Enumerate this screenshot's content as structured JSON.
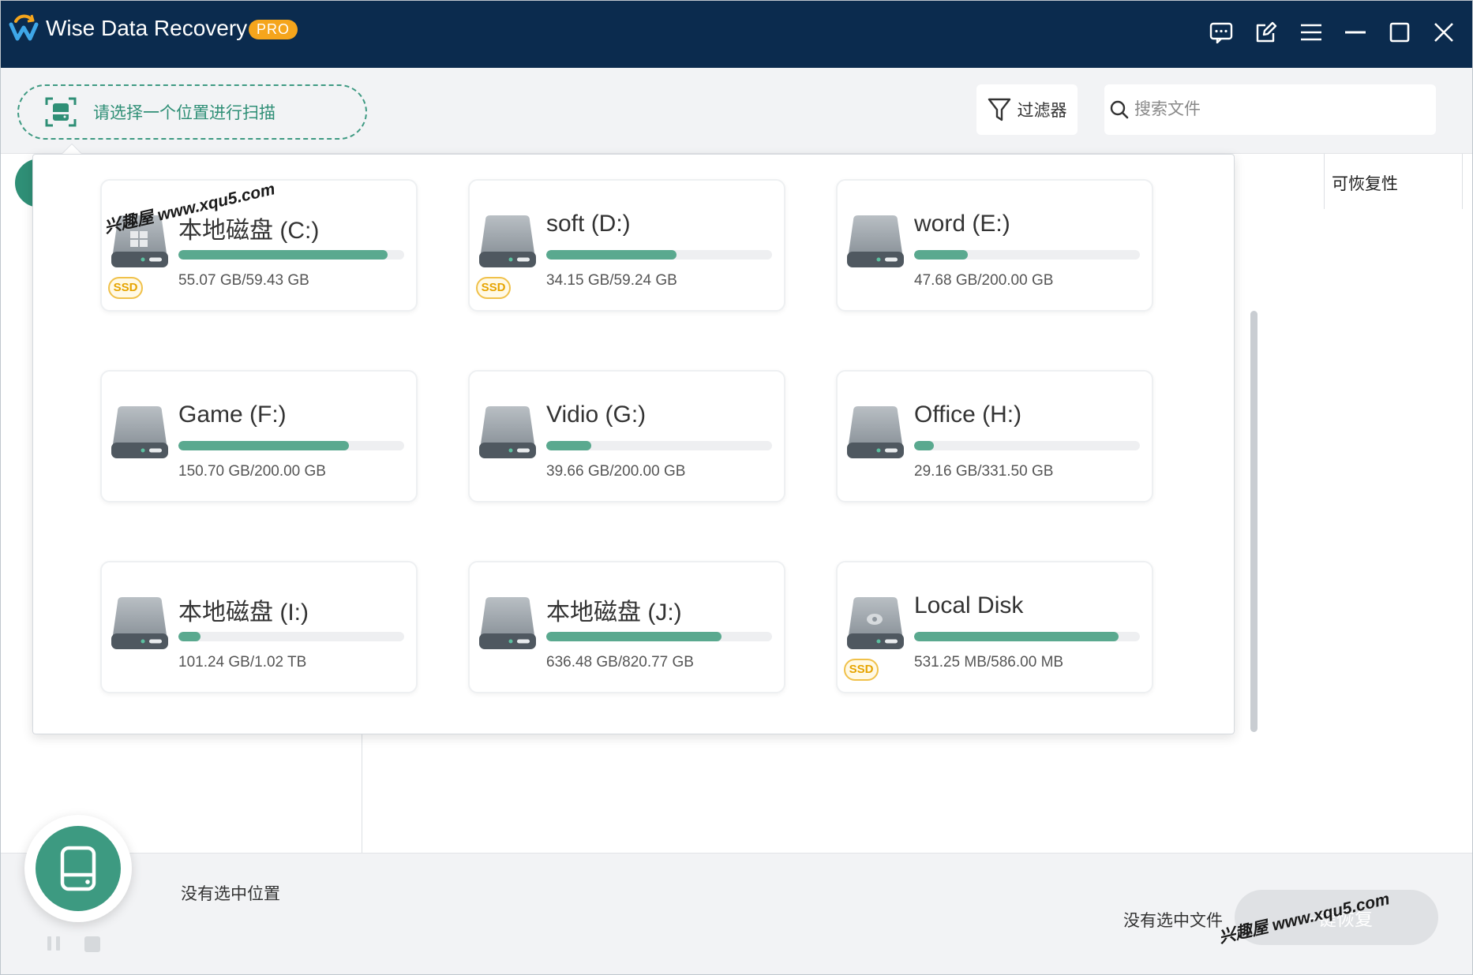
{
  "app": {
    "title": "Wise Data Recovery",
    "badge": "PRO"
  },
  "titlebar_buttons": [
    "feedback-icon",
    "edit-icon",
    "menu-icon",
    "minimize-icon",
    "maximize-icon",
    "close-icon"
  ],
  "toolbar": {
    "location_prompt": "请选择一个位置进行扫描",
    "filter_label": "过滤器",
    "search_placeholder": "搜索文件"
  },
  "column_header": "可恢复性",
  "drives": [
    {
      "name": "本地磁盘 (C:)",
      "usage": "55.07 GB/59.43 GB",
      "used_fraction": 0.927,
      "ssd": true,
      "icon": "windows-drive-icon"
    },
    {
      "name": "soft (D:)",
      "usage": "34.15 GB/59.24 GB",
      "used_fraction": 0.576,
      "ssd": true,
      "icon": "hard-drive-icon"
    },
    {
      "name": "word (E:)",
      "usage": "47.68 GB/200.00 GB",
      "used_fraction": 0.238,
      "ssd": false,
      "icon": "hard-drive-icon"
    },
    {
      "name": "Game (F:)",
      "usage": "150.70 GB/200.00 GB",
      "used_fraction": 0.754,
      "ssd": false,
      "icon": "hard-drive-icon"
    },
    {
      "name": "Vidio (G:)",
      "usage": "39.66 GB/200.00 GB",
      "used_fraction": 0.198,
      "ssd": false,
      "icon": "hard-drive-icon"
    },
    {
      "name": "Office (H:)",
      "usage": "29.16 GB/331.50 GB",
      "used_fraction": 0.088,
      "ssd": false,
      "icon": "hard-drive-icon"
    },
    {
      "name": "本地磁盘 (I:)",
      "usage": "101.24 GB/1.02 TB",
      "used_fraction": 0.097,
      "ssd": false,
      "icon": "hard-drive-icon"
    },
    {
      "name": "本地磁盘 (J:)",
      "usage": "636.48 GB/820.77 GB",
      "used_fraction": 0.775,
      "ssd": false,
      "icon": "hard-drive-icon"
    },
    {
      "name": "Local Disk",
      "usage": "531.25 MB/586.00 MB",
      "used_fraction": 0.907,
      "ssd": true,
      "icon": "system-drive-icon"
    }
  ],
  "ssd_label": "SSD",
  "bottom": {
    "no_location": "没有选中位置",
    "no_file": "没有选中文件",
    "recover_label": "一键恢复"
  },
  "watermark": "兴趣屋 www.xqu5.com",
  "colors": {
    "titlebar": "#0b2b4e",
    "accent": "#3d9a81",
    "pro_badge": "#f5a51c",
    "ssd_badge": "#e6a400"
  }
}
